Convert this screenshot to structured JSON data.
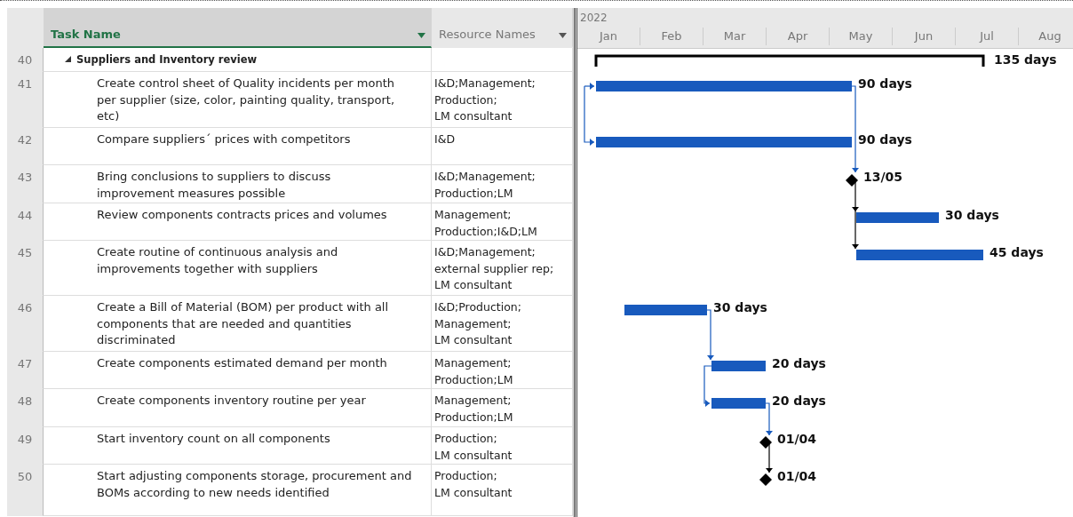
{
  "timescale": {
    "year": "2022",
    "months": [
      "Jan",
      "Feb",
      "Mar",
      "Apr",
      "May",
      "Jun",
      "Jul",
      "Aug"
    ]
  },
  "columns": [
    {
      "label": "Task Name",
      "selected": true
    },
    {
      "label": "Resource Names",
      "selected": false
    }
  ],
  "rows": [
    {
      "id": "40",
      "task": "Suppliers and Inventory review",
      "kind": "summary",
      "expanded": true,
      "resources": "",
      "gantt_label": "135 days"
    },
    {
      "id": "41",
      "task": "Create control sheet of Quality incidents per month\nper supplier (size, color, painting quality, transport,\netc)",
      "kind": "task",
      "resources": "I&D;Management;\nProduction;\nLM consultant",
      "gantt_label": "90 days"
    },
    {
      "id": "42",
      "task": "Compare suppliers´ prices with competitors",
      "kind": "task",
      "resources": "I&D",
      "gantt_label": "90 days"
    },
    {
      "id": "43",
      "task": "Bring conclusions to suppliers to discuss\nimprovement measures possible",
      "kind": "milestone",
      "resources": "I&D;Management;\nProduction;LM",
      "gantt_label": "13/05"
    },
    {
      "id": "44",
      "task": "Review components contracts prices and volumes",
      "kind": "task",
      "resources": "Management;\nProduction;I&D;LM",
      "gantt_label": "30 days"
    },
    {
      "id": "45",
      "task": "Create routine of continuous analysis and\nimprovements together with suppliers",
      "kind": "task",
      "resources": "I&D;Management;\nexternal supplier rep;\nLM consultant",
      "gantt_label": "45 days"
    },
    {
      "id": "46",
      "task": "Create a Bill of Material (BOM) per product with all\ncomponents that are needed and quantities\ndiscriminated",
      "kind": "task",
      "resources": "I&D;Production;\nManagement;\nLM consultant",
      "gantt_label": "30 days"
    },
    {
      "id": "47",
      "task": "Create components estimated demand per month",
      "kind": "task",
      "resources": "Management;\nProduction;LM",
      "gantt_label": "20 days"
    },
    {
      "id": "48",
      "task": "Create components inventory routine per year",
      "kind": "task",
      "resources": "Management;\nProduction;LM",
      "gantt_label": "20 days"
    },
    {
      "id": "49",
      "task": "Start inventory count on all components",
      "kind": "milestone",
      "resources": "Production;\nLM consultant",
      "gantt_label": "01/04"
    },
    {
      "id": "50",
      "task": "Start adjusting components storage, procurement and\nBOMs according to new needs identified",
      "kind": "milestone",
      "resources": "Production;\nLM consultant",
      "gantt_label": "01/04"
    }
  ]
}
